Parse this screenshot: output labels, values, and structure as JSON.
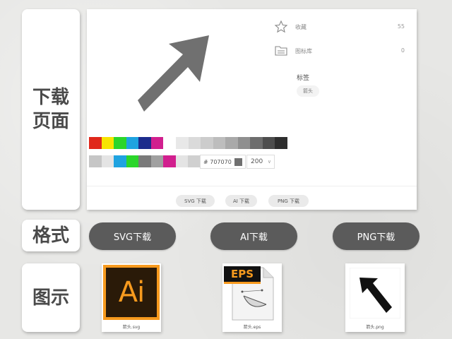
{
  "labels": {
    "download_page": "下载\n页面",
    "format": "格式",
    "example": "图示"
  },
  "preview": {
    "icon": "arrow-up-right-icon",
    "fill_color": "#707070"
  },
  "palette": {
    "colors_row1": [
      "#e0281b",
      "#f7e400",
      "#2bd62b",
      "#1fa3e0",
      "#1c2c8c",
      "#d11f8e"
    ],
    "grays_row1": [
      "#e8e8e8",
      "#dadada",
      "#cccccc",
      "#bdbdbd",
      "#a9a9a9",
      "#8f8f8f",
      "#6d6d6d",
      "#4d4d4d",
      "#2e2e2e"
    ],
    "colors_row2": [
      "#c6c6c6",
      "#e4e4e4",
      "#1fa3e0",
      "#2bd62b",
      "#7a7a7a",
      "#a0a0a0",
      "#d11f8e",
      "#e4e4e4",
      "#d0d0d0"
    ]
  },
  "controls": {
    "hex_value": "# 707070",
    "size_value": "200"
  },
  "stats": {
    "favorites_label": "收藏",
    "favorites_count": "55",
    "library_label": "图标库",
    "library_count": "0"
  },
  "tags": {
    "title": "标签",
    "items": [
      "箭头"
    ]
  },
  "download_buttons": {
    "svg": "SVG 下载",
    "ai": "AI 下载",
    "png": "PNG 下载"
  },
  "format_buttons": {
    "svg": "SVG下载",
    "ai": "AI下载",
    "png": "PNG下载"
  },
  "examples": {
    "ai_glyph": "Ai",
    "eps_glyph": "EPS",
    "svg_caption": "箭头.svg",
    "eps_caption": "箭头.eps",
    "png_caption": "箭头.png"
  },
  "colors": {
    "button_dark": "#5b5b5b",
    "ai_orange": "#f79a1e",
    "arrow_gray": "#707070"
  }
}
